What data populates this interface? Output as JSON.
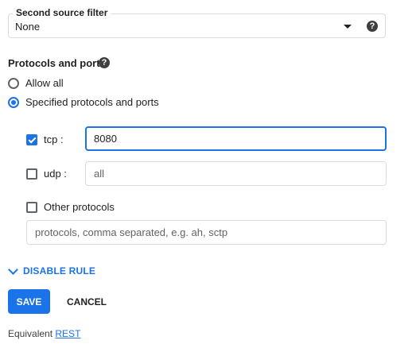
{
  "source_filter": {
    "label": "Second source filter",
    "value": "None"
  },
  "protocols": {
    "title": "Protocols and ports",
    "options": [
      {
        "label": "Allow all",
        "selected": false
      },
      {
        "label": "Specified protocols and ports",
        "selected": true
      }
    ],
    "tcp": {
      "label": "tcp :",
      "checked": true,
      "value": "8080"
    },
    "udp": {
      "label": "udp :",
      "checked": false,
      "placeholder": "all"
    },
    "other": {
      "label": "Other protocols",
      "checked": false,
      "placeholder": "protocols, comma separated, e.g. ah, sctp"
    }
  },
  "disable_rule_label": "DISABLE RULE",
  "actions": {
    "save": "SAVE",
    "cancel": "CANCEL"
  },
  "footer": {
    "prefix": "Equivalent",
    "link": "REST"
  },
  "help_glyph": "?",
  "colors": {
    "accent": "#1a73e8",
    "border": "#dadce0",
    "text": "#202124"
  }
}
